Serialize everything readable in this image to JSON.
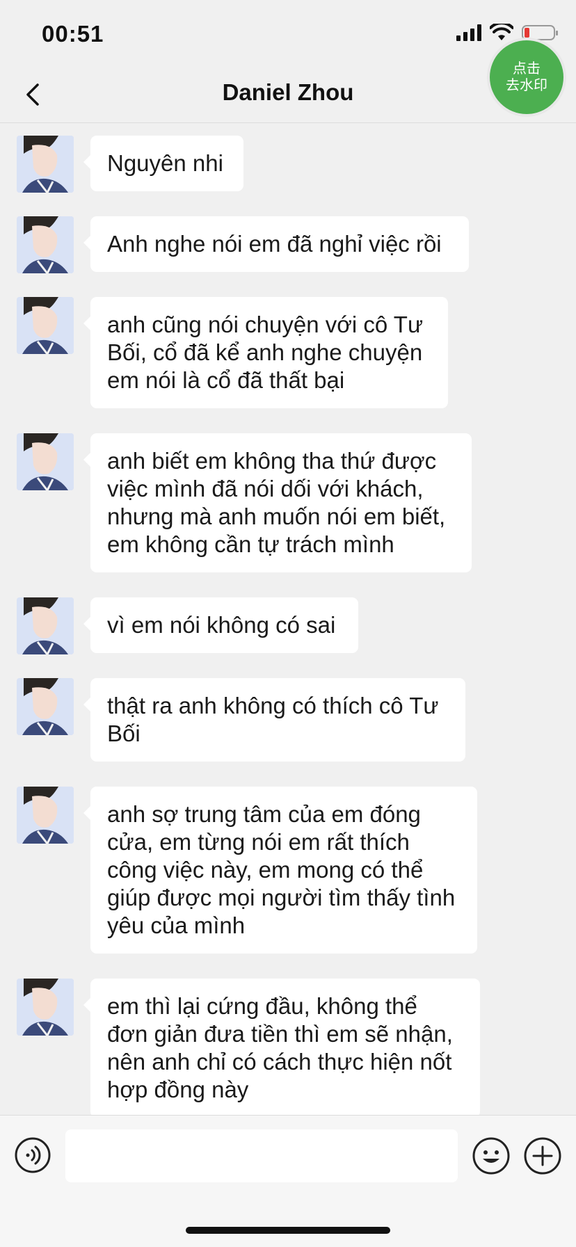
{
  "status": {
    "time": "00:51",
    "battery_color": "#e53935"
  },
  "header": {
    "title": "Daniel Zhou",
    "back_icon": "chevron-left-icon"
  },
  "watermark_button": {
    "line1": "点击",
    "line2": "去水印",
    "color": "#4caf50"
  },
  "messages": [
    {
      "text": "Nguyên nhi"
    },
    {
      "text": "Anh nghe nói em đã nghỉ việc rồi"
    },
    {
      "text": "anh cũng nói chuyện với cô Tư Bối, cổ đã kể anh nghe chuyện em nói là cổ đã thất bại"
    },
    {
      "text": "anh biết em không tha thứ được việc mình đã nói dối với khách, nhưng mà anh muốn nói em biết, em không cần tự trách mình"
    },
    {
      "text": "vì em nói không có sai"
    },
    {
      "text": "thật ra anh không có thích cô Tư Bối"
    },
    {
      "text": "anh sợ trung tâm của em đóng cửa, em từng nói em rất thích công việc này, em mong có thể giúp được mọi người tìm thấy tình yêu của mình"
    },
    {
      "text": "em thì lại cứng đầu, không thể đơn giản đưa tiền thì em sẽ nhận, nên anh chỉ có cách thực hiện nốt hợp đồng này"
    }
  ],
  "input_bar": {
    "value": "",
    "voice_icon": "voice-icon",
    "emoji_icon": "emoji-icon",
    "plus_icon": "plus-icon"
  }
}
